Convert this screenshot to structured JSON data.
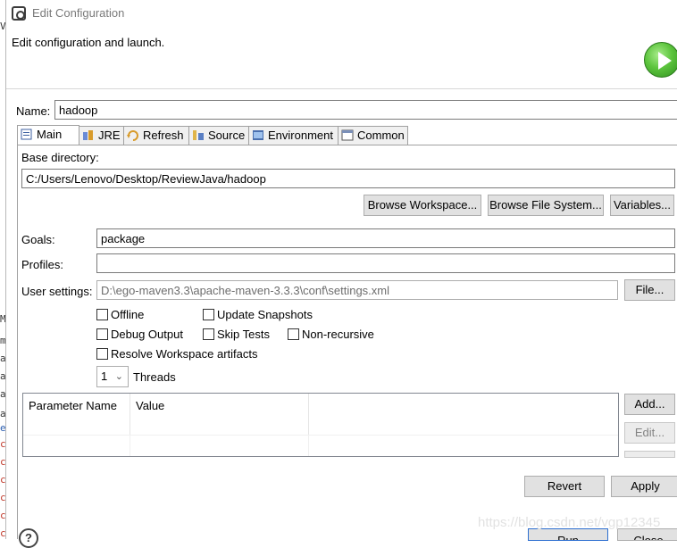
{
  "window": {
    "title": "Edit Configuration",
    "header": "Edit configuration and launch."
  },
  "bg_chars": [
    {
      "t": "V",
      "c": ""
    },
    {
      "t": "",
      "c": ""
    },
    {
      "t": "M",
      "c": ""
    },
    {
      "t": "m",
      "c": ""
    },
    {
      "t": "a",
      "c": ""
    },
    {
      "t": "a",
      "c": ""
    },
    {
      "t": "a",
      "c": ""
    },
    {
      "t": "a",
      "c": ""
    },
    {
      "t": "e",
      "c": "blue"
    },
    {
      "t": "c",
      "c": "red"
    },
    {
      "t": "c",
      "c": "red"
    },
    {
      "t": "c",
      "c": "red"
    },
    {
      "t": "c",
      "c": "red"
    },
    {
      "t": "c",
      "c": "red"
    },
    {
      "t": "c",
      "c": "red"
    }
  ],
  "name": {
    "label": "Name:",
    "value": "hadoop"
  },
  "tabs": [
    {
      "label": "Main",
      "icon": "main-tab-icon",
      "active": true
    },
    {
      "label": "JRE",
      "icon": "jre-tab-icon"
    },
    {
      "label": "Refresh",
      "icon": "refresh-tab-icon"
    },
    {
      "label": "Source",
      "icon": "source-tab-icon"
    },
    {
      "label": "Environment",
      "icon": "environment-tab-icon"
    },
    {
      "label": "Common",
      "icon": "common-tab-icon"
    }
  ],
  "main": {
    "base_dir_label": "Base directory:",
    "base_dir_value": "C:/Users/Lenovo/Desktop/ReviewJava/hadoop",
    "browse_workspace": "Browse Workspace...",
    "browse_filesystem": "Browse File System...",
    "variables": "Variables...",
    "goals_label": "Goals:",
    "goals_value": "package",
    "profiles_label": "Profiles:",
    "profiles_value": "",
    "user_settings_label": "User settings:",
    "user_settings_value": "D:\\ego-maven3.3\\apache-maven-3.3.3\\conf\\settings.xml",
    "file_button": "File...",
    "checkboxes": {
      "offline": "Offline",
      "update_snapshots": "Update Snapshots",
      "debug_output": "Debug Output",
      "skip_tests": "Skip Tests",
      "non_recursive": "Non-recursive",
      "resolve_workspace": "Resolve Workspace artifacts"
    },
    "threads_value": "1",
    "threads_label": "Threads",
    "table": {
      "col_name": "Parameter Name",
      "col_value": "Value"
    },
    "add_button": "Add...",
    "edit_button": "Edit..."
  },
  "footer": {
    "revert": "Revert",
    "apply": "Apply",
    "run": "Run",
    "close": "Close",
    "help": "?",
    "watermark": "https://blog.csdn.net/vgp12345"
  }
}
